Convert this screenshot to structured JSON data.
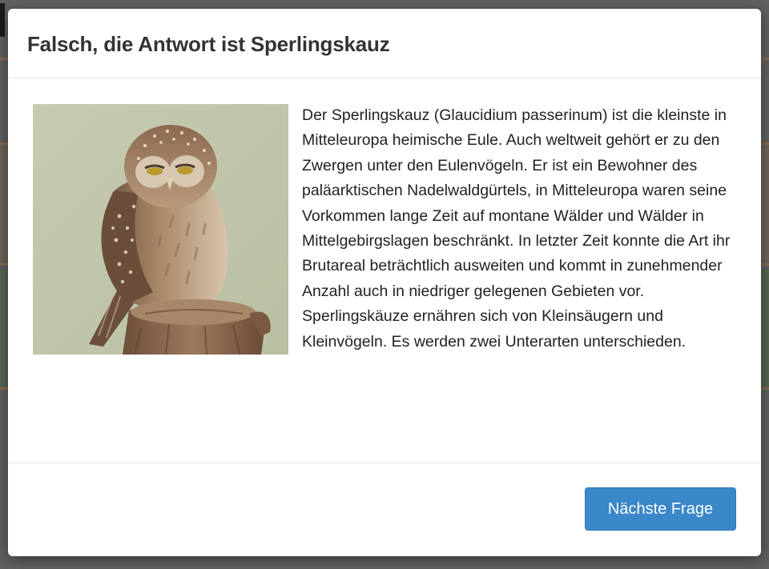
{
  "modal": {
    "title": "Falsch, die Antwort ist Sperlingskauz",
    "image": {
      "subject": "Sperlingskauz",
      "icon": "owl-photo",
      "colors": {
        "background": "#c9cdb3",
        "owl": "#8a6b52",
        "stump": "#7a5d45"
      }
    },
    "description": "Der Sperlingskauz (Glaucidium passerinum) ist die kleinste in Mitteleuropa heimische Eule. Auch weltweit gehört er zu den Zwergen unter den Eulenvögeln. Er ist ein Bewohner des paläarktischen Nadelwaldgürtels, in Mitteleuropa waren seine Vorkommen lange Zeit auf montane Wälder und Wälder in Mittelgebirgslagen beschränkt. In letzter Zeit konnte die Art ihr Brutareal beträchtlich ausweiten und kommt in zunehmender Anzahl auch in niedriger gelegenen Gebieten vor. Sperlingskäuze ernähren sich von Kleinsäugern und Kleinvögeln. Es werden zwei Unterarten unterschieden.",
    "next_button_label": "Nächste Frage"
  },
  "colors": {
    "accent": "#3a87c9",
    "title_text": "#333333",
    "body_text": "#222222",
    "backdrop": "#616161"
  }
}
